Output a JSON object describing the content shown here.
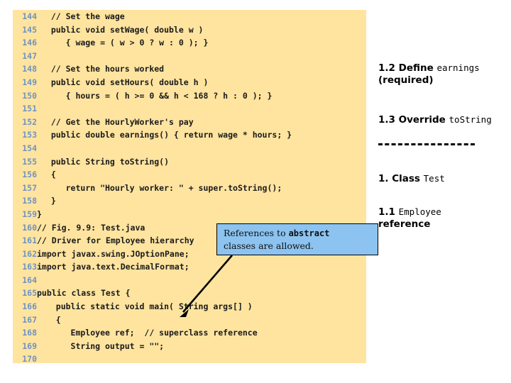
{
  "code_panel": {
    "background_color": "#ffe4a0",
    "line_number_color": "#6f93c0",
    "lines": [
      {
        "num": "144",
        "text": "  // Set the wage"
      },
      {
        "num": "145",
        "text": "  public void setWage( double w )"
      },
      {
        "num": "146",
        "text": "     { wage = ( w > 0 ? w : 0 ); }"
      },
      {
        "num": "147",
        "text": ""
      },
      {
        "num": "148",
        "text": "  // Set the hours worked"
      },
      {
        "num": "149",
        "text": "  public void setHours( double h )"
      },
      {
        "num": "150",
        "text": "     { hours = ( h >= 0 && h < 168 ? h : 0 ); }"
      },
      {
        "num": "151",
        "text": ""
      },
      {
        "num": "152",
        "text": "  // Get the HourlyWorker's pay"
      },
      {
        "num": "153",
        "text": "  public double earnings() { return wage * hours; }"
      },
      {
        "num": "154",
        "text": ""
      },
      {
        "num": "155",
        "text": "  public String toString()"
      },
      {
        "num": "156",
        "text": "  {"
      },
      {
        "num": "157",
        "text": "     return \"Hourly worker: \" + super.toString();"
      },
      {
        "num": "158",
        "text": "  }"
      },
      {
        "num": "159",
        "text": "}",
        "tight": true
      },
      {
        "num": "160",
        "text": "// Fig. 9.9: Test.java",
        "tight": true
      },
      {
        "num": "161",
        "text": "// Driver for Employee hierarchy",
        "tight": true
      },
      {
        "num": "162",
        "text": "import javax.swing.JOptionPane;",
        "tight": true
      },
      {
        "num": "163",
        "text": "import java.text.DecimalFormat;",
        "tight": true
      },
      {
        "num": "164",
        "text": "",
        "tight": true
      },
      {
        "num": "165",
        "text": "public class Test {",
        "tight": true
      },
      {
        "num": "166",
        "text": "   public static void main( String args[] )"
      },
      {
        "num": "167",
        "text": "   {"
      },
      {
        "num": "168",
        "text": "      Employee ref;  // superclass reference"
      },
      {
        "num": "169",
        "text": "      String output = \"\";"
      },
      {
        "num": "170",
        "text": ""
      }
    ]
  },
  "callout": {
    "background_color": "#8cc3f0",
    "border_color": "#000000",
    "line1_prefix": "References to ",
    "line1_code": "abstract",
    "line2": "classes are allowed."
  },
  "notes": {
    "earnings": {
      "line1_prefix": "1.2 Define ",
      "line1_code": "earnings",
      "line2": "(required)"
    },
    "tostring": {
      "prefix": "1.3 Override ",
      "code": "toString"
    },
    "divider": "------------------------",
    "class_test": {
      "prefix": "1. Class ",
      "code": "Test"
    },
    "employee_reference": {
      "prefix": "1.1 ",
      "code": "Employee",
      "suffix": "reference"
    }
  }
}
